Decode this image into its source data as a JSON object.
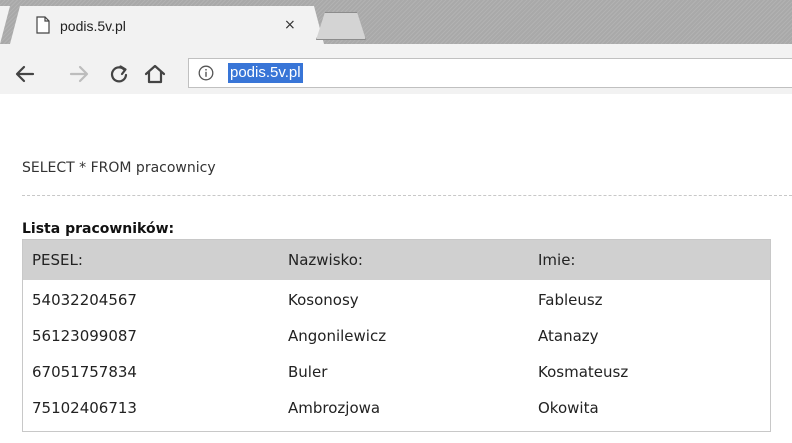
{
  "browser": {
    "tab_title": "podis.5v.pl",
    "tab_close_glyph": "×",
    "url": "podis.5v.pl"
  },
  "page": {
    "query": "SELECT * FROM pracownicy",
    "list_title": "Lista pracowników:",
    "table": {
      "headers": [
        "PESEL:",
        "Nazwisko:",
        "Imie:"
      ],
      "rows": [
        [
          "54032204567",
          "Kosonosy",
          "Fableusz"
        ],
        [
          "56123099087",
          "Angonilewicz",
          "Atanazy"
        ],
        [
          "67051757834",
          "Buler",
          "Kosmateusz"
        ],
        [
          "75102406713",
          "Ambrozjowa",
          "Okowita"
        ]
      ]
    }
  },
  "colors": {
    "url_highlight": "#3875d7",
    "header_bg": "#d0d0d0"
  }
}
